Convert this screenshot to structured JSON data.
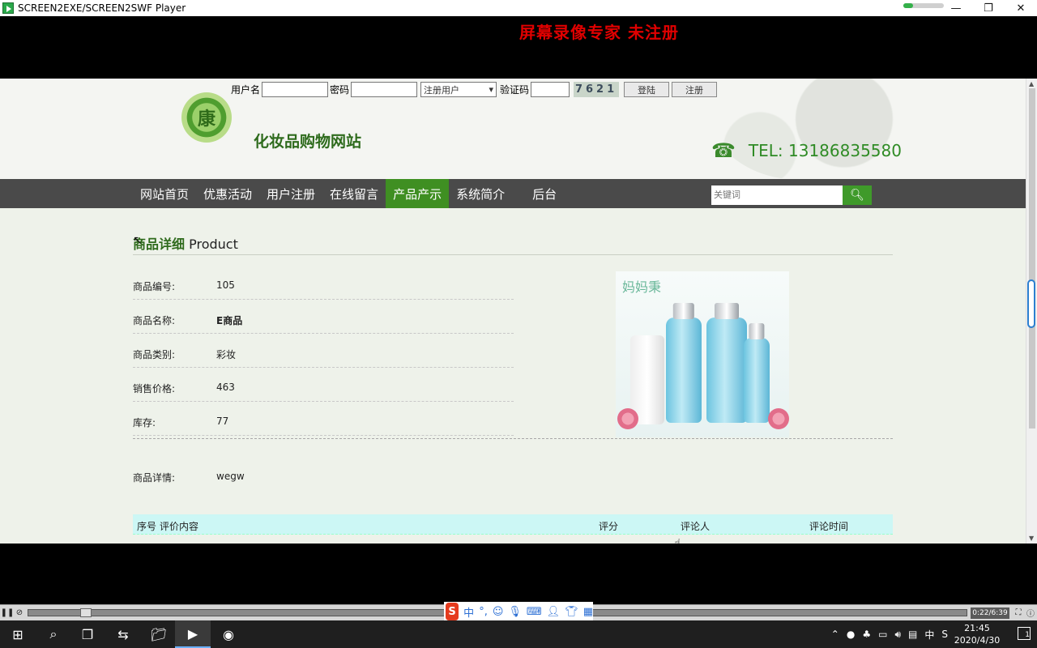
{
  "window": {
    "title": "SCREEN2EXE/SCREEN2SWF Player",
    "minimize_glyph": "—",
    "restore_glyph": "❐",
    "close_glyph": "✕"
  },
  "watermark": "屏幕录像专家  未注册",
  "login": {
    "username_label": "用户名",
    "password_label": "密码",
    "role_select_value": "注册用户",
    "captcha_label": "验证码",
    "captcha_image_text": "7621",
    "login_button": "登陆",
    "register_button": "注册"
  },
  "header": {
    "logo_char": "康",
    "site_name": "化妆品购物网站",
    "tel_text": "TEL: 13186835580"
  },
  "nav": {
    "items": [
      "网站首页",
      "优惠活动",
      "用户注册",
      "在线留言",
      "产品产示",
      "系统简介",
      "后台"
    ],
    "active_index": 4,
    "search_placeholder": "关键词"
  },
  "product": {
    "section_title_cn": "商品详细",
    "section_title_en": " Product",
    "fields": [
      {
        "label": "商品编号:",
        "value": "105"
      },
      {
        "label": "商品名称:",
        "value": "E商品"
      },
      {
        "label": "商品类别:",
        "value": "彩妆"
      },
      {
        "label": "销售价格:",
        "value": "463"
      },
      {
        "label": "库存:",
        "value": "77"
      }
    ],
    "image_brand_text": "妈妈秉",
    "detail_label": "商品详情:",
    "detail_value": "wegw"
  },
  "reviews": {
    "headers": [
      "序号",
      "评价内容",
      "评分",
      "评论人",
      "评论时间"
    ]
  },
  "player": {
    "progress": 0.056,
    "time": "0:22/6:39"
  },
  "ime": {
    "logo": "S",
    "mode": "中",
    "punct": "°,"
  },
  "taskbar": {
    "start_icon": "windows-icon",
    "tray_lang": "中",
    "time": "21:45",
    "date": "2020/4/30",
    "notification_count": "1"
  },
  "colors": {
    "nav_active": "#3f8f22",
    "site_green": "#2e6b1d",
    "watermark_red": "#e00000",
    "review_header_bg": "#ccf7f5"
  }
}
